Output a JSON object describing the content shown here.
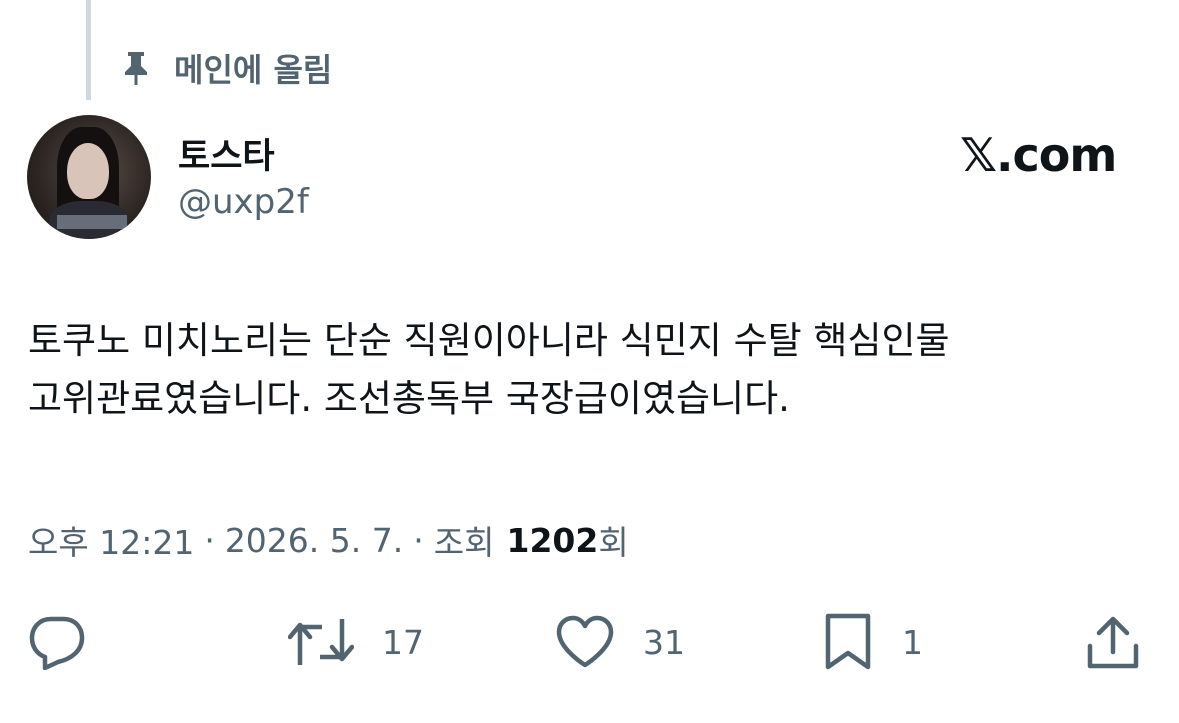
{
  "pinned": {
    "label": "메인에 올림",
    "icon": "pin-icon"
  },
  "author": {
    "name": "토스타",
    "handle": "@uxp2f",
    "avatar": "avatar"
  },
  "brand": "𝕏.com",
  "tweet": {
    "line1": "토쿠노 미치노리는 단순 직원이아니라 식민지 수탈 핵심인물",
    "line2": "고위관료였습니다. 조선총독부 국장급이였습니다."
  },
  "meta": {
    "time": "오후 12:21",
    "sep": "·",
    "date": "2026. 5. 7.",
    "views_label": "조회",
    "views_count": "1202",
    "views_suffix": "회"
  },
  "actions": {
    "reply": {
      "icon": "reply-icon"
    },
    "retweet": {
      "icon": "retweet-icon",
      "count": "17"
    },
    "like": {
      "icon": "heart-icon",
      "count": "31"
    },
    "bookmark": {
      "icon": "bookmark-icon",
      "count": "1"
    },
    "share": {
      "icon": "share-icon"
    }
  },
  "colors": {
    "text": "#0f1419",
    "secondary": "#536471",
    "thread_line": "#cfd9de"
  }
}
